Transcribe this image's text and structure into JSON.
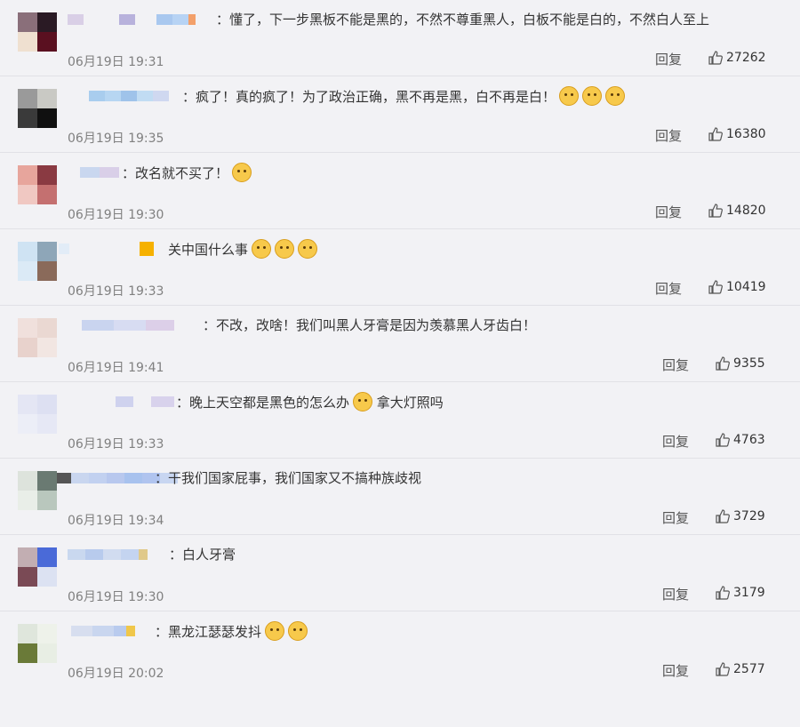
{
  "comments": [
    {
      "text": "：懂了，下一步黑板不能是黑的，不然不尊重黑人，白板不能是白的，不然白人至上",
      "emojis": [],
      "time": "06月19日 19:31",
      "reply": "回复",
      "likes": "27262"
    },
    {
      "text": "：疯了！真的疯了！为了政治正确，黑不再是黑，白不再是白！",
      "emojis": [
        "crying-face-icon",
        "crying-face-icon",
        "crying-face-icon"
      ],
      "time": "06月19日 19:35",
      "reply": "回复",
      "likes": "16380"
    },
    {
      "text": "：改名就不买了！",
      "emojis": [
        "doge-icon"
      ],
      "time": "06月19日 19:30",
      "reply": "回复",
      "likes": "14820"
    },
    {
      "text": "关中国什么事",
      "emojis": [
        "smirk-face-icon",
        "smirk-face-icon",
        "smirk-face-icon"
      ],
      "time": "06月19日 19:33",
      "reply": "回复",
      "likes": "10419"
    },
    {
      "text": "：不改，改啥！我们叫黑人牙膏是因为羡慕黑人牙齿白！",
      "emojis": [],
      "time": "06月19日 19:41",
      "reply": "回复",
      "likes": "9355"
    },
    {
      "text": "：晚上天空都是黑色的怎么办",
      "text_after": "拿大灯照吗",
      "emojis": [
        "thinking-face-icon"
      ],
      "time": "06月19日 19:33",
      "reply": "回复",
      "likes": "4763"
    },
    {
      "text": "：干我们国家屁事，我们国家又不搞种族歧视",
      "emojis": [],
      "time": "06月19日 19:34",
      "reply": "回复",
      "likes": "3729"
    },
    {
      "text": "：白人牙膏",
      "emojis": [],
      "time": "06月19日 19:30",
      "reply": "回复",
      "likes": "3179"
    },
    {
      "text": "：黑龙江瑟瑟发抖",
      "emojis": [
        "doge-icon",
        "doge-icon"
      ],
      "time": "06月19日 20:02",
      "reply": "回复",
      "likes": "2577"
    }
  ],
  "colors": {
    "background": "#f2f2f5",
    "divider": "#e1e1e6",
    "time_text": "#808080",
    "emoji_yellow": "#f7c94b",
    "badge_gold": "#f6b100"
  }
}
